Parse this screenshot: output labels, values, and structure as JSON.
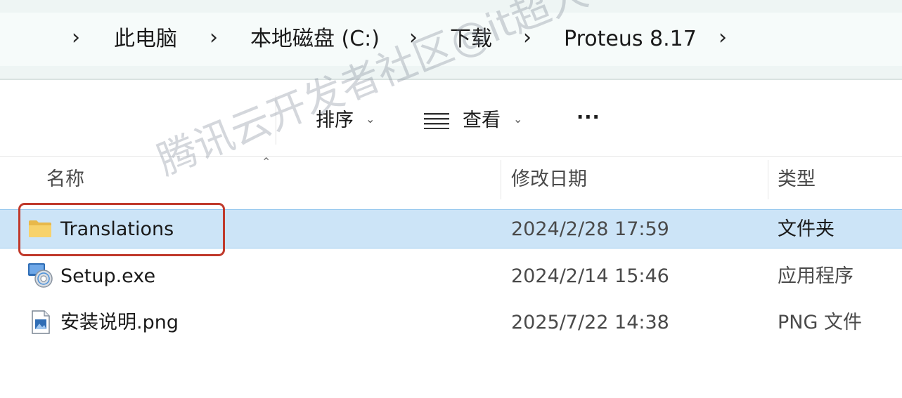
{
  "breadcrumb": {
    "items": [
      "此电脑",
      "本地磁盘 (C:)",
      "下载",
      "Proteus 8.17"
    ]
  },
  "toolbar": {
    "sort_label": "排序",
    "view_label": "查看",
    "more_label": "···"
  },
  "columns": {
    "name": "名称",
    "modified": "修改日期",
    "type": "类型"
  },
  "files": [
    {
      "name": "Translations",
      "modified": "2024/2/28 17:59",
      "type": "文件夹",
      "icon": "folder-icon",
      "selected": true
    },
    {
      "name": "Setup.exe",
      "modified": "2024/2/14 15:46",
      "type": "应用程序",
      "icon": "installer-icon",
      "selected": false
    },
    {
      "name": "安装说明.png",
      "modified": "2025/7/22 14:38",
      "type": "PNG 文件",
      "icon": "image-file-icon",
      "selected": false
    }
  ],
  "watermark": "腾讯云开发者社区@it超人",
  "colors": {
    "selection": "#cce4f7",
    "highlight_box": "#c0392b"
  }
}
